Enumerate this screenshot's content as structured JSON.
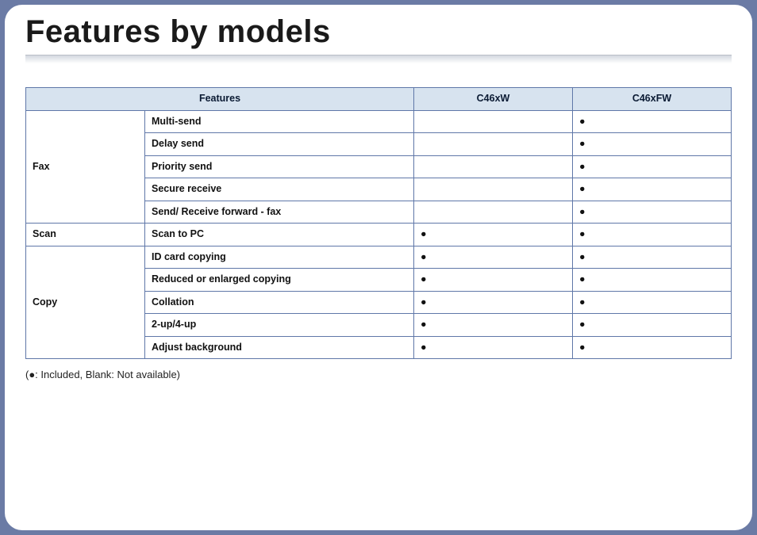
{
  "title": "Features by models",
  "columns": {
    "features": "Features",
    "model1": "C46xW",
    "model2": "C46xFW"
  },
  "categories": [
    {
      "name": "Fax",
      "rows": [
        {
          "feature": "Multi-send",
          "m1": "",
          "m2": "●"
        },
        {
          "feature": "Delay send",
          "m1": "",
          "m2": "●"
        },
        {
          "feature": "Priority send",
          "m1": "",
          "m2": "●"
        },
        {
          "feature": "Secure receive",
          "m1": "",
          "m2": "●"
        },
        {
          "feature": "Send/ Receive forward - fax",
          "m1": "",
          "m2": "●"
        }
      ]
    },
    {
      "name": "Scan",
      "rows": [
        {
          "feature": "Scan to PC",
          "m1": "●",
          "m2": "●"
        }
      ]
    },
    {
      "name": "Copy",
      "rows": [
        {
          "feature": "ID card copying",
          "m1": "●",
          "m2": "●"
        },
        {
          "feature": "Reduced or enlarged copying",
          "m1": "●",
          "m2": "●"
        },
        {
          "feature": "Collation",
          "m1": "●",
          "m2": "●"
        },
        {
          "feature": "2-up/4-up",
          "m1": "●",
          "m2": "●"
        },
        {
          "feature": "Adjust background",
          "m1": "●",
          "m2": "●"
        }
      ]
    }
  ],
  "footnote": "(●: Included, Blank: Not available)"
}
